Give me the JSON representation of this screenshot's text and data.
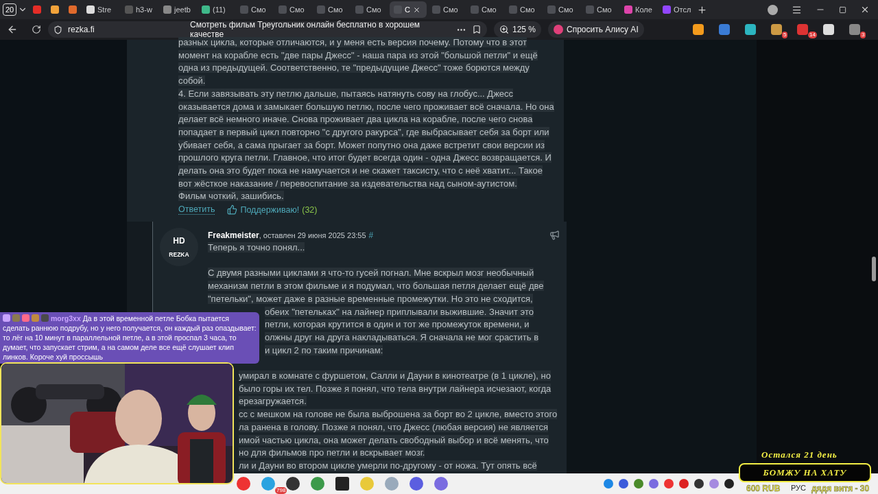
{
  "browser": {
    "tab_count": "20",
    "tabs": [
      {
        "kind": "youtube",
        "selected": false
      },
      {
        "kind": "m",
        "selected": false
      },
      {
        "kind": "game",
        "selected": false
      },
      {
        "kind": "stream",
        "label": "Stre",
        "selected": false
      },
      {
        "kind": "h3w",
        "label": "h3-w",
        "selected": false
      },
      {
        "kind": "jeet",
        "label": "jeetb",
        "selected": false
      },
      {
        "kind": "g",
        "label": "(11)",
        "selected": false
      },
      {
        "kind": "hd",
        "label": "Смо",
        "selected": false
      },
      {
        "kind": "hd",
        "label": "Смо",
        "selected": false
      },
      {
        "kind": "hd",
        "label": "Смо",
        "selected": false
      },
      {
        "kind": "hd",
        "label": "Смо",
        "selected": false
      },
      {
        "kind": "hd",
        "label": "С",
        "selected": true
      },
      {
        "kind": "hd",
        "label": "Смо",
        "selected": false
      },
      {
        "kind": "hd",
        "label": "Смо",
        "selected": false
      },
      {
        "kind": "hd",
        "label": "Смо",
        "selected": false
      },
      {
        "kind": "hd",
        "label": "Смо",
        "selected": false
      },
      {
        "kind": "hd",
        "label": "Смо",
        "selected": false
      },
      {
        "kind": "color",
        "label": "Коле",
        "selected": false
      },
      {
        "kind": "twitch",
        "label": "Отсл",
        "selected": false
      }
    ],
    "url": "rezka.fi",
    "page_title": "Смотреть фильм Треугольник онлайн бесплатно в хорошем качестве",
    "zoom": "125 %",
    "assistant": "Спросить Алису AI",
    "extensions": [
      {
        "kind": "orange"
      },
      {
        "kind": "translate"
      },
      {
        "kind": "seven"
      },
      {
        "kind": "owl",
        "badge": "5"
      },
      {
        "kind": "red",
        "badge": "14"
      },
      {
        "kind": "play"
      },
      {
        "kind": "puzzle",
        "badge": "3"
      }
    ]
  },
  "comment_1": {
    "lines": [
      "разных цикла, которые отличаются, и у меня есть версия почему. Потому что в этот",
      "момент на корабле есть \"две пары Джесс\" - наша пара из этой \"большой петли\" и ещё",
      "одна из предыдущей. Соответственно, те \"предыдущие Джесс\" тоже борются между",
      "собой.",
      "4. Если завязывать эту петлю дальше, пытаясь натянуть сову на глобус... Джесс",
      "оказывается дома и замыкает большую петлю, после чего проживает всё сначала. Но она",
      "делает всё немного иначе. Снова проживает два цикла на корабле, после чего снова",
      "попадает в первый цикл повторно \"с другого ракурса\", где выбрасывает себя за борт или",
      "убивает себя, а сама прыгает за борт. Может попутно она даже встретит свои версии из",
      "прошлого круга петли. Главное, что итог будет всегда один - одна Джесс возвращается. И",
      "делать она это будет пока не намучается и не скажет таксисту, что с неё хватит... Такое",
      "вот жёсткое наказание / перевоспитание за издевательства над сыном-аутистом.",
      "Фильм чоткий, зашибись."
    ],
    "reply": "Ответить",
    "support": "Поддерживаю!",
    "support_count": "(32)"
  },
  "comment_2": {
    "avatar_top": "HD",
    "avatar_bottom": "REZKA",
    "author": "Freakmeister",
    "meta": ", оставлен 29 июня 2025 23:55",
    "anchor": "#",
    "lines": [
      {
        "kind": "full",
        "text": "Теперь я точно понял..."
      },
      {
        "kind": "full",
        "space_before": true,
        "text": " С двумя разными циклами я что-то гусей погнал. Мне вскрыл мозг необычный"
      },
      {
        "kind": "full",
        "text": "механизм петли в этом фильме и я подумал, что большая петля делает ещё две"
      },
      {
        "kind": "full",
        "text": "\"петельки\", может даже в разные временные промежутки. Но это не сходится,"
      },
      {
        "kind": "chat",
        "text": "обеих \"петельках\" на лайнер приплывали выжившие. Значит это"
      },
      {
        "kind": "chat",
        "text": "петли, которая крутится в один и тот же промежуток времени, и"
      },
      {
        "kind": "chat",
        "text": "олжны друг на друга накладываться. Я сначала не мог срастить в"
      },
      {
        "kind": "chat",
        "text": "и цикл 2 по таким причинам:"
      },
      {
        "kind": "cam",
        "space_before": true,
        "text": "умирал в комнате с фуршетом, Салли и Дауни в кинотеатре (в 1 цикле), но"
      },
      {
        "kind": "cam",
        "text": "было горы их тел. Позже я понял, что тела внутри лайнера исчезают, когда"
      },
      {
        "kind": "cam",
        "text": "ерезагружается."
      },
      {
        "kind": "cam",
        "text": "сс с мешком на голове не была выброшена за борт во 2 цикле, вместо этого"
      },
      {
        "kind": "cam",
        "text": "ла ранена в голову. Позже я понял, что Джесс (любая версия) не является"
      },
      {
        "kind": "cam",
        "text": "имой частью цикла, она может делать свободный выбор и всё менять, что"
      },
      {
        "kind": "cam",
        "text": "но для фильмов про петли и вскрывает мозг."
      },
      {
        "kind": "cam",
        "text": "ли и Дауни во втором цикле умерли по-другому - от ножа. Тут опять всё"
      }
    ]
  },
  "chat_overlay": {
    "user": "morg3xx",
    "message": "Да в этой временной петле Бобка пытается сделать раннюю подрубу, но у него получается, он каждый раз опаздывает: то лёг на 10 минут в параллельной петле, а в этой проспал 3 часа, то думает, что запускает стрим, а на самом деле все ещё слушает клип линков. Короче хуй проссышь"
  },
  "taskbar": {
    "apps": [
      {
        "kind": "yandex"
      },
      {
        "kind": "telegram",
        "badge": "798"
      },
      {
        "kind": "obs"
      },
      {
        "kind": "chrome"
      },
      {
        "kind": "h"
      },
      {
        "kind": "lock"
      },
      {
        "kind": "notepad"
      },
      {
        "kind": "chat"
      },
      {
        "kind": "s"
      }
    ],
    "tray": [
      {
        "kind": "t"
      },
      {
        "kind": "chat"
      },
      {
        "kind": "nvidia"
      },
      {
        "kind": "s"
      },
      {
        "kind": "yandex"
      },
      {
        "kind": "red"
      },
      {
        "kind": "obs"
      },
      {
        "kind": "feather"
      },
      {
        "kind": "g"
      }
    ],
    "language": "РУС"
  },
  "stream_widget": {
    "days_left": "Остался 21 день",
    "goal": "БОМЖУ НА ХАТУ",
    "amount": "600 RUB",
    "donor": "дядя витя - 30"
  }
}
